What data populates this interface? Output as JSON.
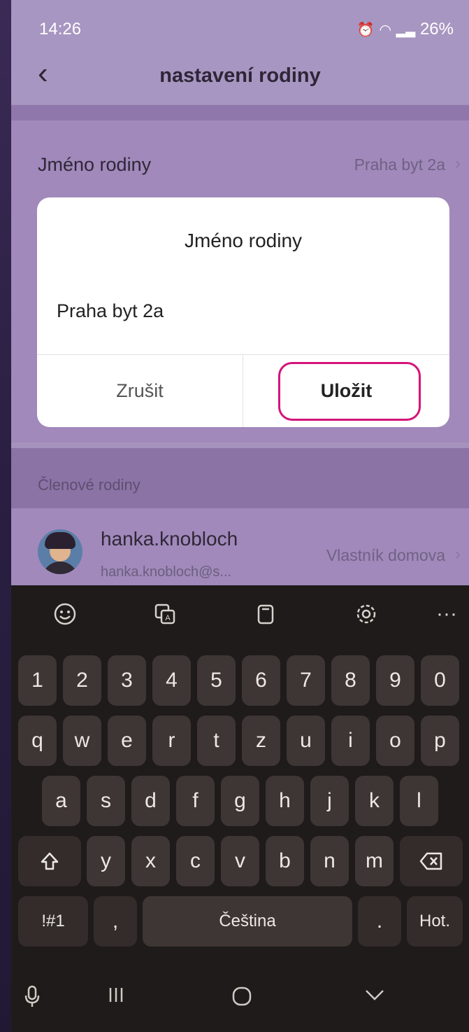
{
  "status_bar": {
    "time": "14:26",
    "right_text": "26%"
  },
  "header": {
    "title": "nastavení rodiny"
  },
  "settings": {
    "family_name_label": "Jméno rodiny",
    "family_name_value": "Praha byt 2a"
  },
  "dialog": {
    "title": "Jméno rodiny",
    "input_value": "Praha byt 2a",
    "cancel_label": "Zrušit",
    "save_label": "Uložit"
  },
  "members": {
    "section_label": "Členové rodiny",
    "items": [
      {
        "name": "hanka.knobloch",
        "email": "hanka.knobloch@s...",
        "role": "Vlastník domova"
      }
    ]
  },
  "keyboard": {
    "toolbar_icons": [
      "emoji-icon",
      "translate-icon",
      "clipboard-icon",
      "settings-icon",
      "more-icon"
    ],
    "more_label": "···",
    "number_row": [
      "1",
      "2",
      "3",
      "4",
      "5",
      "6",
      "7",
      "8",
      "9",
      "0"
    ],
    "row1": [
      "q",
      "w",
      "e",
      "r",
      "t",
      "z",
      "u",
      "i",
      "o",
      "p"
    ],
    "row2": [
      "a",
      "s",
      "d",
      "f",
      "g",
      "h",
      "j",
      "k",
      "l"
    ],
    "row3": [
      "y",
      "x",
      "c",
      "v",
      "b",
      "n",
      "m"
    ],
    "symbols_label": "!#1",
    "comma_label": ",",
    "space_label": "Čeština",
    "period_label": ".",
    "action_label": "Hot."
  },
  "colors": {
    "highlight": "#d4147a",
    "header_bg": "#a796c1"
  }
}
